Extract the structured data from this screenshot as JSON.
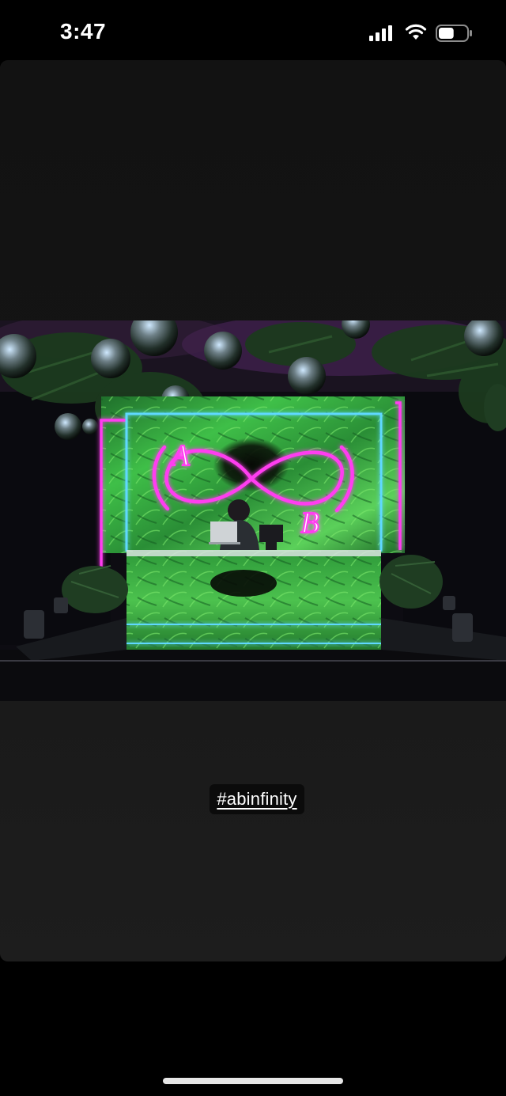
{
  "status_bar": {
    "time": "3:47",
    "icons": [
      "signal-icon",
      "wifi-icon",
      "battery-icon"
    ],
    "battery_level": 0.55
  },
  "story": {
    "photo_monogram": {
      "letter_a": "A",
      "letter_b": "B"
    },
    "hashtag": "#abinfinity"
  },
  "colors": {
    "background": "#000000",
    "card": "#161616",
    "neon_pink": "#ff3df0",
    "neon_blue": "#5fd8ff",
    "foliage": "#2ea83a"
  }
}
